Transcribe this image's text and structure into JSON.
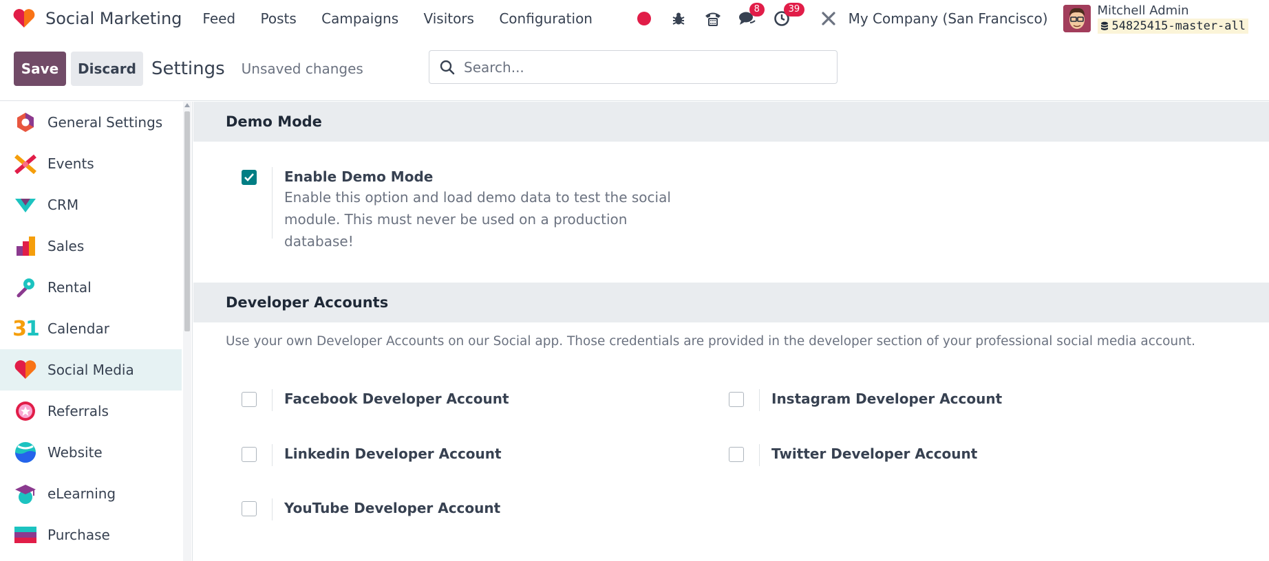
{
  "navbar": {
    "app_name": "Social Marketing",
    "menu": [
      "Feed",
      "Posts",
      "Campaigns",
      "Visitors",
      "Configuration"
    ],
    "messages_count": "8",
    "activities_count": "39",
    "company": "My Company (San Francisco)",
    "user_name": "Mitchell Admin",
    "database": "54825415-master-all"
  },
  "control_panel": {
    "save_label": "Save",
    "discard_label": "Discard",
    "title": "Settings",
    "status": "Unsaved changes",
    "search_placeholder": "Search..."
  },
  "sidebar": {
    "items": [
      {
        "label": "General Settings",
        "icon": "general-settings-icon"
      },
      {
        "label": "Events",
        "icon": "events-icon"
      },
      {
        "label": "CRM",
        "icon": "crm-icon"
      },
      {
        "label": "Sales",
        "icon": "sales-icon"
      },
      {
        "label": "Rental",
        "icon": "rental-icon"
      },
      {
        "label": "Calendar",
        "icon": "calendar-icon",
        "icon_text": "31"
      },
      {
        "label": "Social Media",
        "icon": "social-media-icon",
        "active": true
      },
      {
        "label": "Referrals",
        "icon": "referrals-icon"
      },
      {
        "label": "Website",
        "icon": "website-icon"
      },
      {
        "label": "eLearning",
        "icon": "elearning-icon"
      },
      {
        "label": "Purchase",
        "icon": "purchase-icon"
      }
    ]
  },
  "demo_mode": {
    "heading": "Demo Mode",
    "setting_title": "Enable Demo Mode",
    "description": "Enable this option and load demo data to test the social module. This must never be used on a production database!",
    "checked": true
  },
  "developer_accounts": {
    "heading": "Developer Accounts",
    "intro": "Use your own Developer Accounts on our Social app. Those credentials are provided in the developer section of your professional social media account.",
    "accounts": [
      {
        "label": "Facebook Developer Account",
        "checked": false
      },
      {
        "label": "Instagram Developer Account",
        "checked": false
      },
      {
        "label": "Linkedin Developer Account",
        "checked": false
      },
      {
        "label": "Twitter Developer Account",
        "checked": false
      },
      {
        "label": "YouTube Developer Account",
        "checked": false
      }
    ]
  },
  "colors": {
    "brand": "#714b67",
    "badge": "#e11d48",
    "checkbox_checked": "#017e84",
    "active_sidebar": "#e6f2f3"
  }
}
